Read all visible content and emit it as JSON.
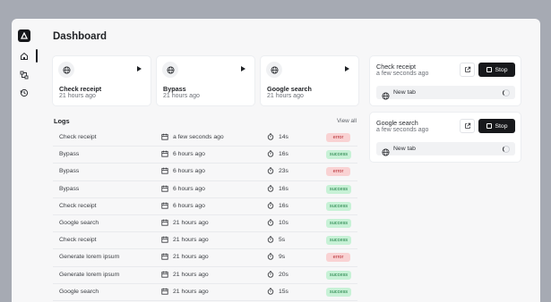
{
  "page": {
    "title": "Dashboard"
  },
  "rail": {
    "icons": [
      "logo-icon",
      "home-icon",
      "workflow-icon",
      "history-icon"
    ]
  },
  "cards": [
    {
      "name": "Check receipt",
      "time": "21 hours ago"
    },
    {
      "name": "Bypass",
      "time": "21 hours ago"
    },
    {
      "name": "Google search",
      "time": "21 hours ago"
    }
  ],
  "logs": {
    "heading": "Logs",
    "view_all": "View all",
    "rows": [
      {
        "name": "Check receipt",
        "when": "a few seconds ago",
        "duration": "14s",
        "status": "error"
      },
      {
        "name": "Bypass",
        "when": "6 hours ago",
        "duration": "16s",
        "status": "success"
      },
      {
        "name": "Bypass",
        "when": "6 hours ago",
        "duration": "23s",
        "status": "error"
      },
      {
        "name": "Bypass",
        "when": "6 hours ago",
        "duration": "16s",
        "status": "success"
      },
      {
        "name": "Check receipt",
        "when": "6 hours ago",
        "duration": "16s",
        "status": "success"
      },
      {
        "name": "Google search",
        "when": "21 hours ago",
        "duration": "10s",
        "status": "success"
      },
      {
        "name": "Check receipt",
        "when": "21 hours ago",
        "duration": "5s",
        "status": "success"
      },
      {
        "name": "Generate lorem ipsum",
        "when": "21 hours ago",
        "duration": "9s",
        "status": "error"
      },
      {
        "name": "Generate lorem ipsum",
        "when": "21 hours ago",
        "duration": "20s",
        "status": "success"
      },
      {
        "name": "Google search",
        "when": "21 hours ago",
        "duration": "15s",
        "status": "success"
      }
    ]
  },
  "running": [
    {
      "name": "Check receipt",
      "time": "a few seconds ago",
      "stop_label": "Stop",
      "tab_label": "New tab"
    },
    {
      "name": "Google search",
      "time": "a few seconds ago",
      "stop_label": "Stop",
      "tab_label": "New tab"
    }
  ],
  "colors": {
    "error_bg": "#f9d2d3",
    "error_text": "#b3262d",
    "success_bg": "#c7f1d6",
    "success_text": "#157a3d",
    "stop_button": "#17181b"
  }
}
